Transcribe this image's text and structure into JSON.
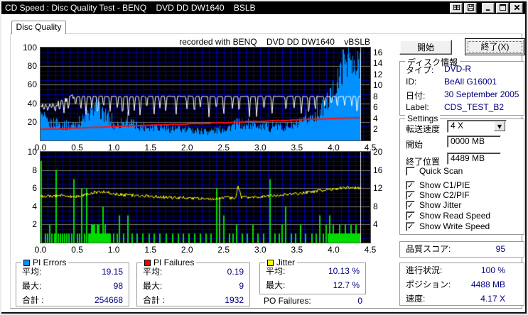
{
  "window": {
    "title": "CD Speed : Disc Quality Test - BENQ    DVD DD DW1640    BSLB",
    "titlebar_icons": [
      "copy-icon",
      "save-icon",
      "minimize-icon",
      "maximize-icon",
      "close-icon"
    ]
  },
  "tab": {
    "label": "Disc Quality"
  },
  "toolbar": {
    "start_label": "開始",
    "exit_label": "終了(X)"
  },
  "disc_info": {
    "title": "ディスク情報",
    "rows": [
      {
        "label": "タイプ:",
        "value": "DVD-R"
      },
      {
        "label": "ID:",
        "value": "BeAll G16001"
      },
      {
        "label": "日付:",
        "value": "30 September 2005"
      },
      {
        "label": "Label:",
        "value": "CDS_TEST_B2"
      }
    ]
  },
  "settings": {
    "title": "Settings",
    "speed_label": "転送速度",
    "speed_value": "4 X",
    "start_label": "開始",
    "start_value": "0000 MB",
    "end_label": "終了位置",
    "end_value": "4489 MB",
    "checkboxes": [
      {
        "label": "Quick Scan",
        "mark": ""
      },
      {
        "label": "Show C1/PIE",
        "mark": "✓"
      },
      {
        "label": "Show C2/PIF",
        "mark": "✓"
      },
      {
        "label": "Show Jitter",
        "mark": "✓"
      },
      {
        "label": "Show Read Speed",
        "mark": "✓"
      },
      {
        "label": "Show Write Speed",
        "mark": "✓"
      }
    ]
  },
  "quality": {
    "label": "品質スコア:",
    "value": "95"
  },
  "progress": {
    "rows": [
      {
        "label": "進行状況:",
        "value": "100 %"
      },
      {
        "label": "ポジション:",
        "value": "4488 MB"
      },
      {
        "label": "速度:",
        "value": "4.17 X"
      }
    ]
  },
  "stats": {
    "pi_errors": {
      "title": "PI Errors",
      "color": "#0090FF",
      "rows": [
        [
          "平均:",
          "19.15"
        ],
        [
          "最大:",
          "98"
        ],
        [
          "合計 :",
          "254668"
        ]
      ]
    },
    "pi_failures": {
      "title": "PI Failures",
      "color": "#FF0000",
      "rows": [
        [
          "平均:",
          "0.19"
        ],
        [
          "最大:",
          "9"
        ],
        [
          "合計 :",
          "1932"
        ]
      ]
    },
    "jitter": {
      "title": "Jitter",
      "color": "#FFFF00",
      "rows": [
        [
          "平均:",
          "10.13 %"
        ],
        [
          "最大:",
          "12.7 %"
        ]
      ]
    },
    "po_failures": {
      "label": "PO Failures:",
      "value": "0"
    }
  },
  "chart_data": [
    {
      "type": "area",
      "title": "recorded with BENQ    DVD DD DW1640    vBSLB",
      "x_range": [
        0,
        4.5
      ],
      "x_ticks": [
        "0.0",
        "0.5",
        "1.0",
        "1.5",
        "2.0",
        "2.5",
        "3.0",
        "3.5",
        "4.0",
        "4.5"
      ],
      "x_grid": 0.1,
      "x_data_end": 4.36,
      "left_axis": {
        "range": [
          0,
          100
        ],
        "ticks": [
          100,
          80,
          60,
          40,
          20
        ],
        "grid_major": 20,
        "grid_minor": 5
      },
      "right_axis": {
        "range": [
          0,
          16.9
        ],
        "ticks": [
          16,
          14,
          12,
          10,
          8,
          6,
          4,
          2
        ]
      },
      "grid_minor_color": "#0000A0",
      "grid_major_color": "#787878",
      "cursor_color": "#E0E0E0",
      "series": [
        {
          "name": "PI Errors",
          "type": "area",
          "axis": "left",
          "color": "#0090FF",
          "points": [
            [
              0,
              26
            ],
            [
              0.1,
              18
            ],
            [
              0.2,
              19
            ],
            [
              0.3,
              17
            ],
            [
              0.4,
              16
            ],
            [
              0.5,
              19
            ],
            [
              0.6,
              24
            ],
            [
              0.7,
              30
            ],
            [
              0.75,
              38
            ],
            [
              0.8,
              33
            ],
            [
              0.9,
              24
            ],
            [
              1,
              16
            ],
            [
              1.1,
              19
            ],
            [
              1.2,
              20
            ],
            [
              1.3,
              16
            ],
            [
              1.4,
              15
            ],
            [
              1.5,
              15
            ],
            [
              1.6,
              15
            ],
            [
              1.7,
              14
            ],
            [
              1.8,
              12
            ],
            [
              1.9,
              12
            ],
            [
              2,
              11
            ],
            [
              2.1,
              11
            ],
            [
              2.2,
              10
            ],
            [
              2.3,
              10
            ],
            [
              2.4,
              11
            ],
            [
              2.5,
              13
            ],
            [
              2.6,
              15
            ],
            [
              2.7,
              19
            ],
            [
              2.8,
              15
            ],
            [
              2.9,
              17
            ],
            [
              3,
              17
            ],
            [
              3.1,
              14
            ],
            [
              3.2,
              14
            ],
            [
              3.3,
              15
            ],
            [
              3.4,
              16
            ],
            [
              3.5,
              17
            ],
            [
              3.6,
              20
            ],
            [
              3.7,
              26
            ],
            [
              3.8,
              31
            ],
            [
              3.9,
              40
            ],
            [
              4,
              55
            ],
            [
              4.05,
              62
            ],
            [
              4.1,
              75
            ],
            [
              4.15,
              88
            ],
            [
              4.2,
              92
            ],
            [
              4.25,
              78
            ],
            [
              4.3,
              72
            ],
            [
              4.36,
              90
            ]
          ],
          "noise": 0.22
        },
        {
          "name": "Write Speed",
          "type": "line",
          "axis": "right",
          "color": "#FFFFFF",
          "points": [
            [
              0,
              6.0
            ],
            [
              0.06,
              6.6
            ],
            [
              0.12,
              6.2
            ],
            [
              0.2,
              6.6
            ],
            [
              0.28,
              6.9
            ],
            [
              0.35,
              7.4
            ],
            [
              0.42,
              7.9
            ],
            [
              0.5,
              8.0
            ],
            [
              4.36,
              8.0
            ]
          ],
          "noisy_until": 0.45,
          "dips": [
            [
              0.05,
              5.6
            ],
            [
              0.1,
              5.2
            ],
            [
              0.15,
              5.8
            ],
            [
              0.2,
              5.0
            ],
            [
              0.26,
              5.5
            ],
            [
              0.32,
              5.0
            ],
            [
              0.38,
              5.6
            ],
            [
              0.48,
              6.2
            ],
            [
              0.55,
              5.4
            ],
            [
              0.62,
              4.6
            ],
            [
              0.7,
              5.6
            ],
            [
              0.78,
              4.4
            ],
            [
              0.86,
              6.0
            ],
            [
              0.95,
              5.2
            ],
            [
              1.05,
              5.6
            ],
            [
              1.12,
              4.2
            ],
            [
              1.2,
              3.9
            ],
            [
              1.28,
              5.4
            ],
            [
              1.36,
              4.1
            ],
            [
              1.45,
              5.6
            ],
            [
              1.55,
              4.4
            ],
            [
              1.63,
              5.8
            ],
            [
              1.71,
              4.8
            ],
            [
              1.85,
              4.2
            ],
            [
              2.0,
              5.4
            ],
            [
              2.1,
              4.6
            ],
            [
              2.18,
              5.8
            ],
            [
              2.3,
              3.9
            ],
            [
              2.4,
              5.4
            ],
            [
              2.5,
              4.4
            ],
            [
              2.62,
              5.6
            ],
            [
              2.71,
              4.8
            ],
            [
              2.85,
              4.0
            ],
            [
              2.95,
              3.9
            ],
            [
              3.05,
              5.2
            ],
            [
              3.16,
              4.6
            ],
            [
              3.35,
              5.0
            ],
            [
              3.46,
              5.6
            ],
            [
              3.56,
              4.8
            ],
            [
              3.66,
              4.4
            ],
            [
              3.75,
              5.2
            ],
            [
              3.88,
              6.2
            ],
            [
              3.97,
              6.5
            ],
            [
              4.05,
              5.8
            ],
            [
              4.15,
              6.3
            ],
            [
              4.25,
              6.0
            ],
            [
              4.32,
              4.4
            ]
          ]
        },
        {
          "name": "Read Speed",
          "type": "line",
          "axis": "right",
          "color": "#FF1010",
          "start_value": 2.0,
          "end_value": 4.17
        }
      ]
    },
    {
      "type": "bars",
      "x_range": [
        0,
        4.5
      ],
      "x_ticks": [
        "0.0",
        "0.5",
        "1.0",
        "1.5",
        "2.0",
        "2.5",
        "3.0",
        "3.5",
        "4.0",
        "4.5"
      ],
      "x_grid": 0.1,
      "x_data_end": 4.36,
      "left_axis": {
        "range": [
          0,
          10
        ],
        "ticks": [
          10,
          8,
          6,
          4,
          2
        ],
        "grid_major": 2,
        "grid_minor": 0.5
      },
      "right_axis": {
        "range": [
          0,
          20
        ],
        "ticks": [
          20,
          16,
          12,
          8,
          4
        ]
      },
      "grid_minor_color": "#0000A0",
      "grid_major_color": "#787878",
      "cursor_color": "#E0E0E0",
      "series": [
        {
          "name": "PI Failures",
          "type": "bars",
          "axis": "left",
          "color": "#00DC00",
          "bars": [
            [
              0.01,
              9
            ],
            [
              0.07,
              1
            ],
            [
              0.1,
              1
            ],
            [
              0.13,
              2
            ],
            [
              0.16,
              1
            ],
            [
              0.19,
              1
            ],
            [
              0.21,
              8
            ],
            [
              0.24,
              1
            ],
            [
              0.27,
              1
            ],
            [
              0.3,
              1
            ],
            [
              0.33,
              1
            ],
            [
              0.36,
              1
            ],
            [
              0.39,
              1
            ],
            [
              0.43,
              1
            ],
            [
              0.46,
              7
            ],
            [
              0.5,
              1
            ],
            [
              0.53,
              1
            ],
            [
              0.56,
              6
            ],
            [
              0.6,
              1
            ],
            [
              0.63,
              6
            ],
            [
              0.7,
              2
            ],
            [
              0.72,
              2
            ],
            [
              0.74,
              2
            ],
            [
              0.78,
              2
            ],
            [
              0.8,
              2
            ],
            [
              0.85,
              4
            ],
            [
              0.88,
              2
            ],
            [
              0.95,
              1
            ],
            [
              1,
              1
            ],
            [
              1.05,
              1
            ],
            [
              1.08,
              3
            ],
            [
              1.13,
              1
            ],
            [
              1.19,
              3
            ],
            [
              1.25,
              1
            ],
            [
              1.32,
              1
            ],
            [
              1.4,
              1
            ],
            [
              1.48,
              1
            ],
            [
              1.55,
              1
            ],
            [
              1.63,
              1
            ],
            [
              1.72,
              1
            ],
            [
              1.8,
              1
            ],
            [
              1.88,
              1
            ],
            [
              1.95,
              1
            ],
            [
              2.03,
              1
            ],
            [
              2.1,
              1
            ],
            [
              2.18,
              1
            ],
            [
              2.26,
              1
            ],
            [
              2.33,
              1
            ],
            [
              2.41,
              6
            ],
            [
              2.44,
              5
            ],
            [
              2.5,
              3
            ],
            [
              2.58,
              1
            ],
            [
              2.63,
              1
            ],
            [
              2.68,
              2
            ],
            [
              2.75,
              1
            ],
            [
              2.82,
              1
            ],
            [
              2.9,
              2
            ],
            [
              2.97,
              1
            ],
            [
              3.05,
              1
            ],
            [
              3.13,
              7
            ],
            [
              3.2,
              1
            ],
            [
              3.26,
              1
            ],
            [
              3.3,
              2
            ],
            [
              3.35,
              4
            ],
            [
              3.42,
              1
            ],
            [
              3.48,
              1
            ],
            [
              3.55,
              2
            ],
            [
              3.62,
              1
            ],
            [
              3.7,
              1
            ],
            [
              3.76,
              1
            ],
            [
              3.81,
              3
            ],
            [
              3.86,
              1
            ],
            [
              3.9,
              2
            ],
            [
              3.95,
              3
            ],
            [
              4,
              2
            ],
            [
              4.05,
              1
            ],
            [
              4.08,
              2
            ],
            [
              4.13,
              1
            ],
            [
              4.16,
              2
            ],
            [
              4.2,
              1
            ],
            [
              4.24,
              2
            ],
            [
              4.28,
              1
            ],
            [
              4.31,
              2
            ],
            [
              4.34,
              1
            ]
          ],
          "dense_regions": [
            [
              0.66,
              0.95,
              1
            ],
            [
              3.93,
              4.35,
              1
            ]
          ]
        },
        {
          "name": "Jitter",
          "type": "line",
          "axis": "right",
          "color": "#FFFF00",
          "points": [
            [
              0,
              10.2
            ],
            [
              0.15,
              10.3
            ],
            [
              0.3,
              10.4
            ],
            [
              0.45,
              10.1
            ],
            [
              0.6,
              10.4
            ],
            [
              0.7,
              11.0
            ],
            [
              0.85,
              11.3
            ],
            [
              1,
              10.7
            ],
            [
              1.15,
              10.5
            ],
            [
              1.3,
              10.4
            ],
            [
              1.5,
              10.2
            ],
            [
              1.7,
              10.0
            ],
            [
              1.9,
              9.9
            ],
            [
              2.1,
              9.8
            ],
            [
              2.3,
              9.7
            ],
            [
              2.5,
              9.8
            ],
            [
              2.66,
              9.9
            ],
            [
              2.7,
              12.4
            ],
            [
              2.74,
              9.9
            ],
            [
              2.9,
              10.0
            ],
            [
              3.1,
              10.2
            ],
            [
              3.3,
              10.5
            ],
            [
              3.5,
              10.8
            ],
            [
              3.7,
              11.2
            ],
            [
              3.9,
              11.6
            ],
            [
              4.05,
              11.9
            ],
            [
              4.2,
              12.2
            ],
            [
              4.36,
              12.0
            ]
          ],
          "noise": 0.35
        }
      ]
    }
  ]
}
